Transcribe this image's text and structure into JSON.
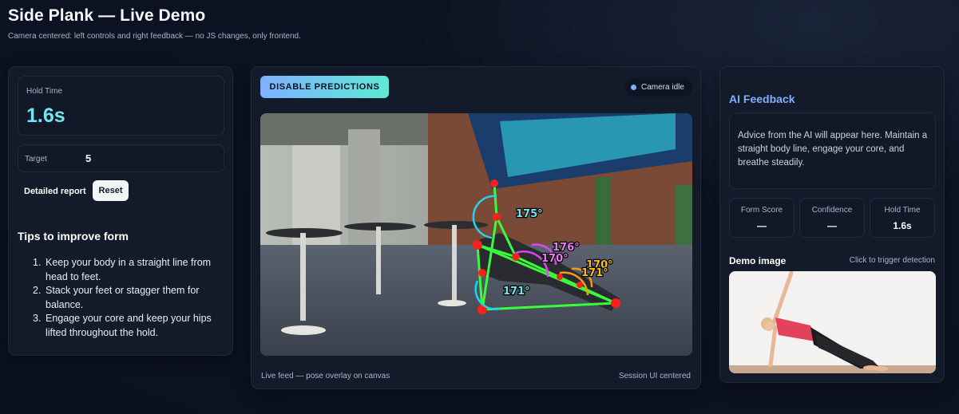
{
  "header": {
    "title": "Side Plank — Live Demo",
    "subtitle": "Camera centered: left controls and right feedback — no JS changes, only frontend."
  },
  "left": {
    "hold_label": "Hold Time",
    "hold_value": "1.6s",
    "target_label": "Target",
    "target_value": "5",
    "report_button": "Detailed report",
    "reset_button": "Reset",
    "tips_title": "Tips to improve form",
    "tips": [
      {
        "num": "1.",
        "text": "Keep your body in a straight line from head to feet."
      },
      {
        "num": "2.",
        "text": "Stack your feet or stagger them for balance."
      },
      {
        "num": "3.",
        "text": "Engage your core and keep your hips lifted throughout the hold."
      }
    ]
  },
  "center": {
    "toggle_button": "DISABLE PREDICTIONS",
    "camera_status": "Camera idle",
    "angles": [
      "175°",
      "176°",
      "170°",
      "170°",
      "171°",
      "171°"
    ],
    "caption_left": "Live feed — pose overlay on canvas",
    "caption_right": "Session UI centered"
  },
  "right": {
    "ai_title": "AI Feedback",
    "ai_text": "Advice from the AI will appear here. Maintain a straight body line, engage your core, and breathe steadily.",
    "metrics": [
      {
        "label": "Form Score",
        "value": "—"
      },
      {
        "label": "Confidence",
        "value": "—"
      },
      {
        "label": "Hold Time",
        "value": "1.6s"
      }
    ],
    "demo_title": "Demo image",
    "demo_hint": "Click to trigger detection"
  },
  "colors": {
    "accent_cyan": "#6ee7f2",
    "accent_blue": "#7fb0ff",
    "pose_green": "#39ff3a",
    "pose_red": "#ff1f1f",
    "pose_cyan": "#22d3ee",
    "pose_magenta": "#d946ef",
    "pose_orange": "#f59e0b"
  },
  "icons": {
    "camera_status": "status-dot-icon"
  }
}
